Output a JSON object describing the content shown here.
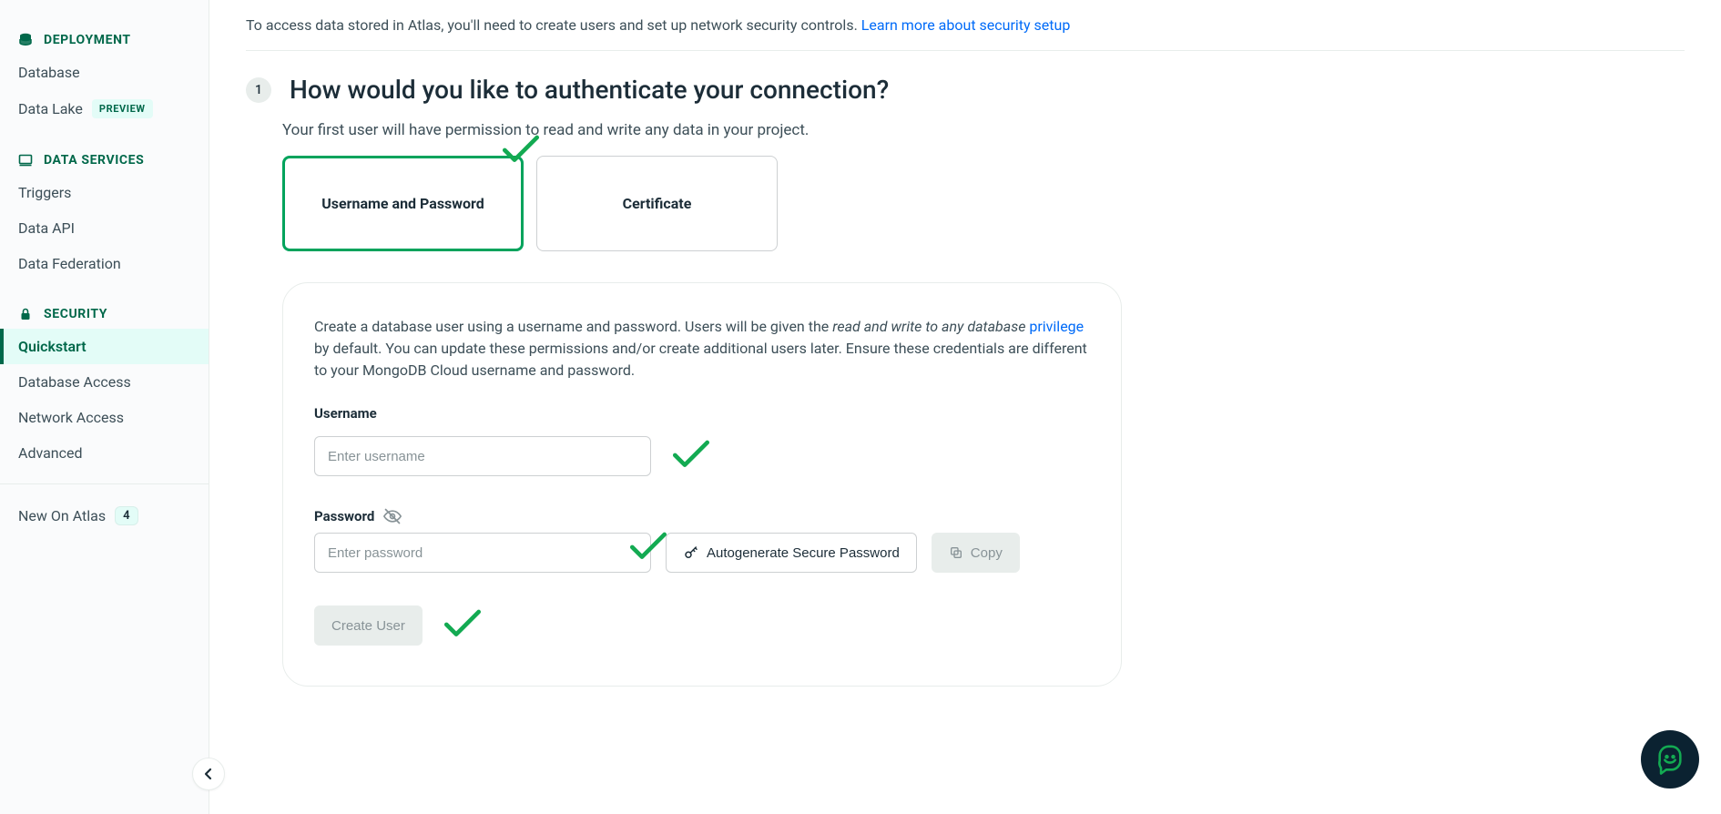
{
  "sidebar": {
    "sections": {
      "deployment": {
        "label": "DEPLOYMENT",
        "items": [
          {
            "label": "Database"
          },
          {
            "label": "Data Lake",
            "preview_badge": "PREVIEW"
          }
        ]
      },
      "data_services": {
        "label": "DATA SERVICES",
        "items": [
          {
            "label": "Triggers"
          },
          {
            "label": "Data API"
          },
          {
            "label": "Data Federation"
          }
        ]
      },
      "security": {
        "label": "SECURITY",
        "items": [
          {
            "label": "Quickstart",
            "active": true
          },
          {
            "label": "Database Access"
          },
          {
            "label": "Network Access"
          },
          {
            "label": "Advanced"
          }
        ]
      }
    },
    "new_on_atlas": {
      "label": "New On Atlas",
      "count": "4"
    }
  },
  "intro": {
    "text": "To access data stored in Atlas, you'll need to create users and set up network security controls. ",
    "link_text": "Learn more about security setup"
  },
  "step": {
    "number": "1",
    "title": "How would you like to authenticate your connection?",
    "subtitle": "Your first user will have permission to read and write any data in your project."
  },
  "auth_options": {
    "username_password": "Username and Password",
    "certificate": "Certificate"
  },
  "form": {
    "intro_part1": "Create a database user using a username and password. Users will be given the ",
    "intro_italic": "read and write to any database ",
    "intro_link": "privilege",
    "intro_part2": " by default. You can update these permissions and/or create additional users later. Ensure these credentials are different to your MongoDB Cloud username and password.",
    "username_label": "Username",
    "username_placeholder": "Enter username",
    "password_label": "Password",
    "password_placeholder": "Enter password",
    "autogenerate_label": "Autogenerate Secure Password",
    "copy_label": "Copy",
    "create_user_label": "Create User"
  }
}
